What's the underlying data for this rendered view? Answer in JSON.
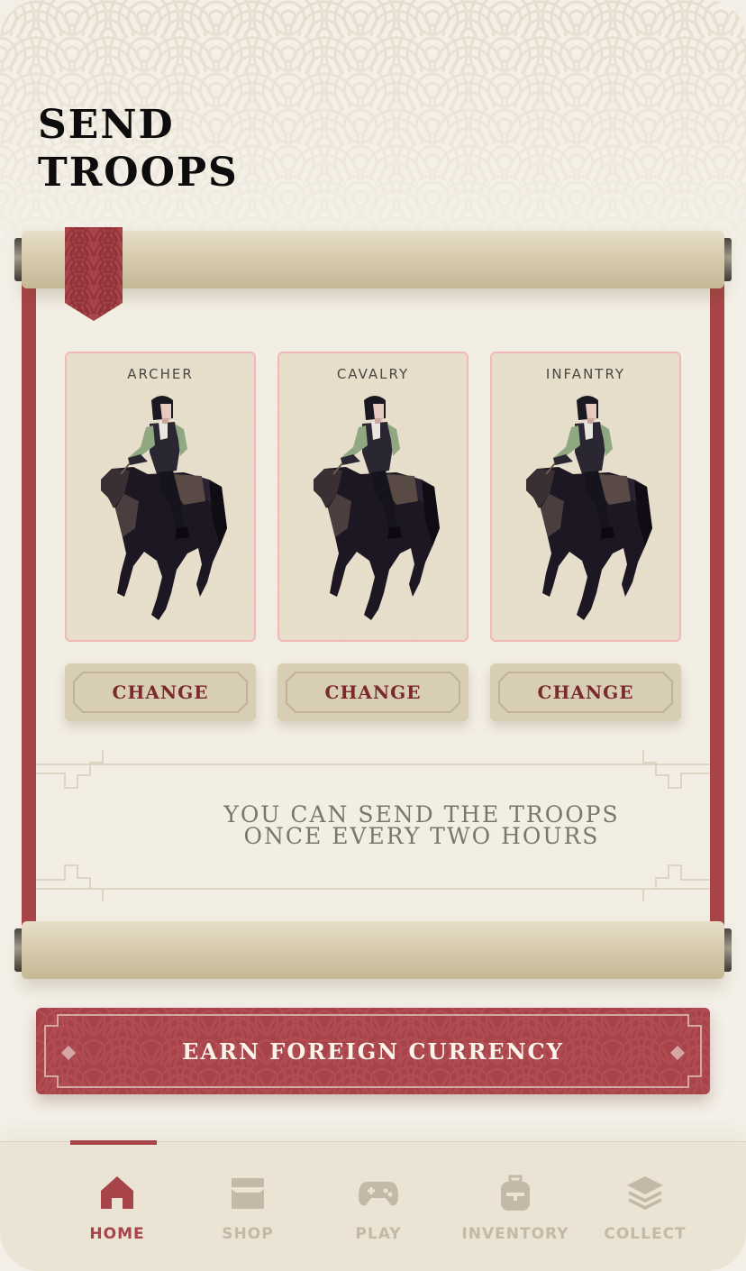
{
  "page": {
    "title": "SEND\nTROOPS"
  },
  "troops": [
    {
      "label": "ARCHER",
      "change_label": "CHANGE"
    },
    {
      "label": "CAVALRY",
      "change_label": "CHANGE"
    },
    {
      "label": "INFANTRY",
      "change_label": "CHANGE"
    }
  ],
  "notice": "YOU CAN SEND THE TROOPS\nONCE EVERY TWO HOURS",
  "earn_button": {
    "label": "EARN FOREIGN CURRENCY"
  },
  "tabs": [
    {
      "label": "HOME",
      "icon": "home-icon",
      "active": true
    },
    {
      "label": "SHOP",
      "icon": "shop-icon",
      "active": false
    },
    {
      "label": "PLAY",
      "icon": "gamepad-icon",
      "active": false
    },
    {
      "label": "INVENTORY",
      "icon": "backpack-icon",
      "active": false
    },
    {
      "label": "COLLECT",
      "icon": "layers-icon",
      "active": false
    }
  ],
  "colors": {
    "accent": "#a8434a",
    "parchment": "#d8ceb3",
    "background": "#f4f0e7",
    "inactive_tab": "#c3b9a6"
  }
}
